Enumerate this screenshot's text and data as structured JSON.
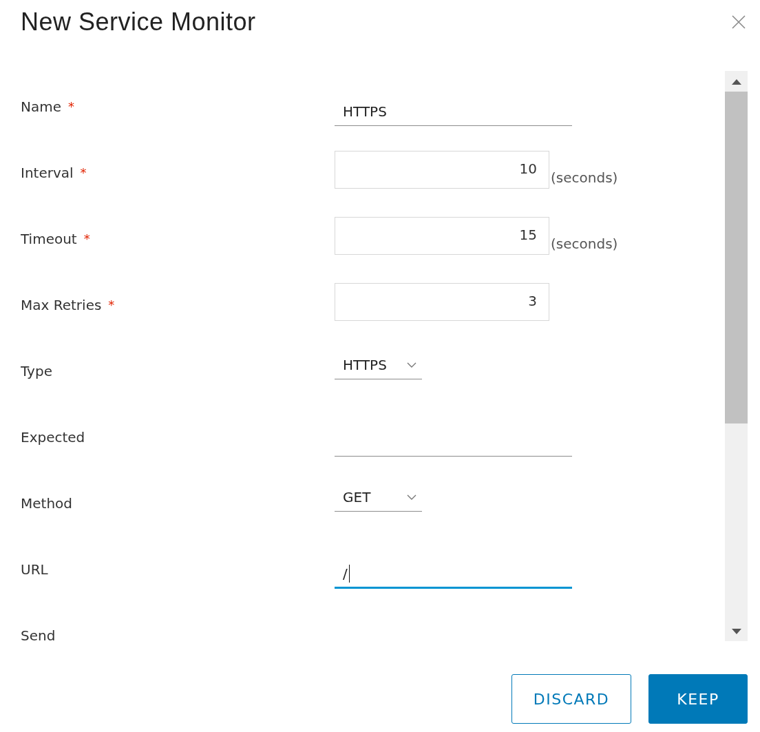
{
  "dialog": {
    "title": "New Service Monitor"
  },
  "required_mark": "*",
  "fields": [
    {
      "label": "Name",
      "required": true,
      "kind": "text",
      "value": "HTTPS",
      "focused": false
    },
    {
      "label": "Interval",
      "required": true,
      "kind": "number",
      "value": "10",
      "unit": "(seconds)"
    },
    {
      "label": "Timeout",
      "required": true,
      "kind": "number",
      "value": "15",
      "unit": "(seconds)"
    },
    {
      "label": "Max Retries",
      "required": true,
      "kind": "number",
      "value": "3"
    },
    {
      "label": "Type",
      "required": false,
      "kind": "select",
      "value": "HTTPS"
    },
    {
      "label": "Expected",
      "required": false,
      "kind": "text",
      "focused": false
    },
    {
      "label": "Method",
      "required": false,
      "kind": "select",
      "value": "GET"
    },
    {
      "label": "URL",
      "required": false,
      "kind": "text",
      "value": "/",
      "focused": true
    },
    {
      "label": "Send",
      "required": false,
      "kind": "none"
    }
  ],
  "buttons": [
    {
      "label": "DISCARD",
      "kind": "secondary"
    },
    {
      "label": "KEEP",
      "kind": "primary"
    }
  ]
}
